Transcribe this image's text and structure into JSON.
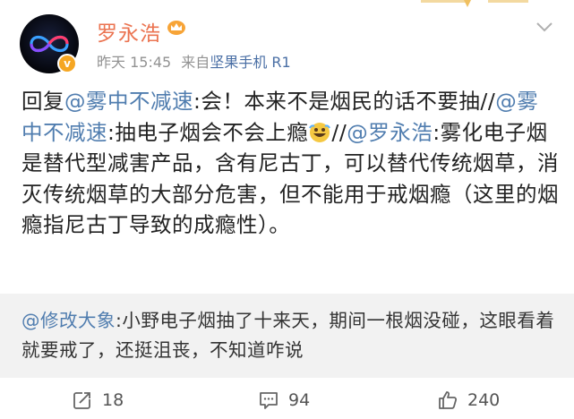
{
  "post": {
    "author": "罗永浩",
    "time": "昨天 15:45",
    "source_prefix": "来自",
    "device": "坚果手机 R1",
    "content": {
      "reply_prefix": "回复",
      "mention1": "@雾中不减速",
      "text1": ":会！本来不是烟民的话不要抽//",
      "mention2": "@雾中不减速",
      "text2": ":抽电子烟会不会上瘾",
      "text3": "//",
      "mention3": "@罗永浩",
      "text4": ":雾化电子烟是替代型减害产品，含有尼古丁，可以替代传统烟草，消灭传统烟草的大部分危害，但不能用于戒烟瘾（这里的烟瘾指尼古丁导致的成瘾性）。"
    }
  },
  "quote": {
    "mention": "@修改大象",
    "text": ":小野电子烟抽了十来天，期间一根烟没碰，这眼看着就要戒了，还挺沮丧，不知道咋说"
  },
  "actions": {
    "repost_count": "18",
    "comment_count": "94",
    "like_count": "240"
  },
  "colors": {
    "username": "#eb7350",
    "mention": "#507daf",
    "quote_bg": "#f2f2f2",
    "verified": "#f5a623"
  }
}
